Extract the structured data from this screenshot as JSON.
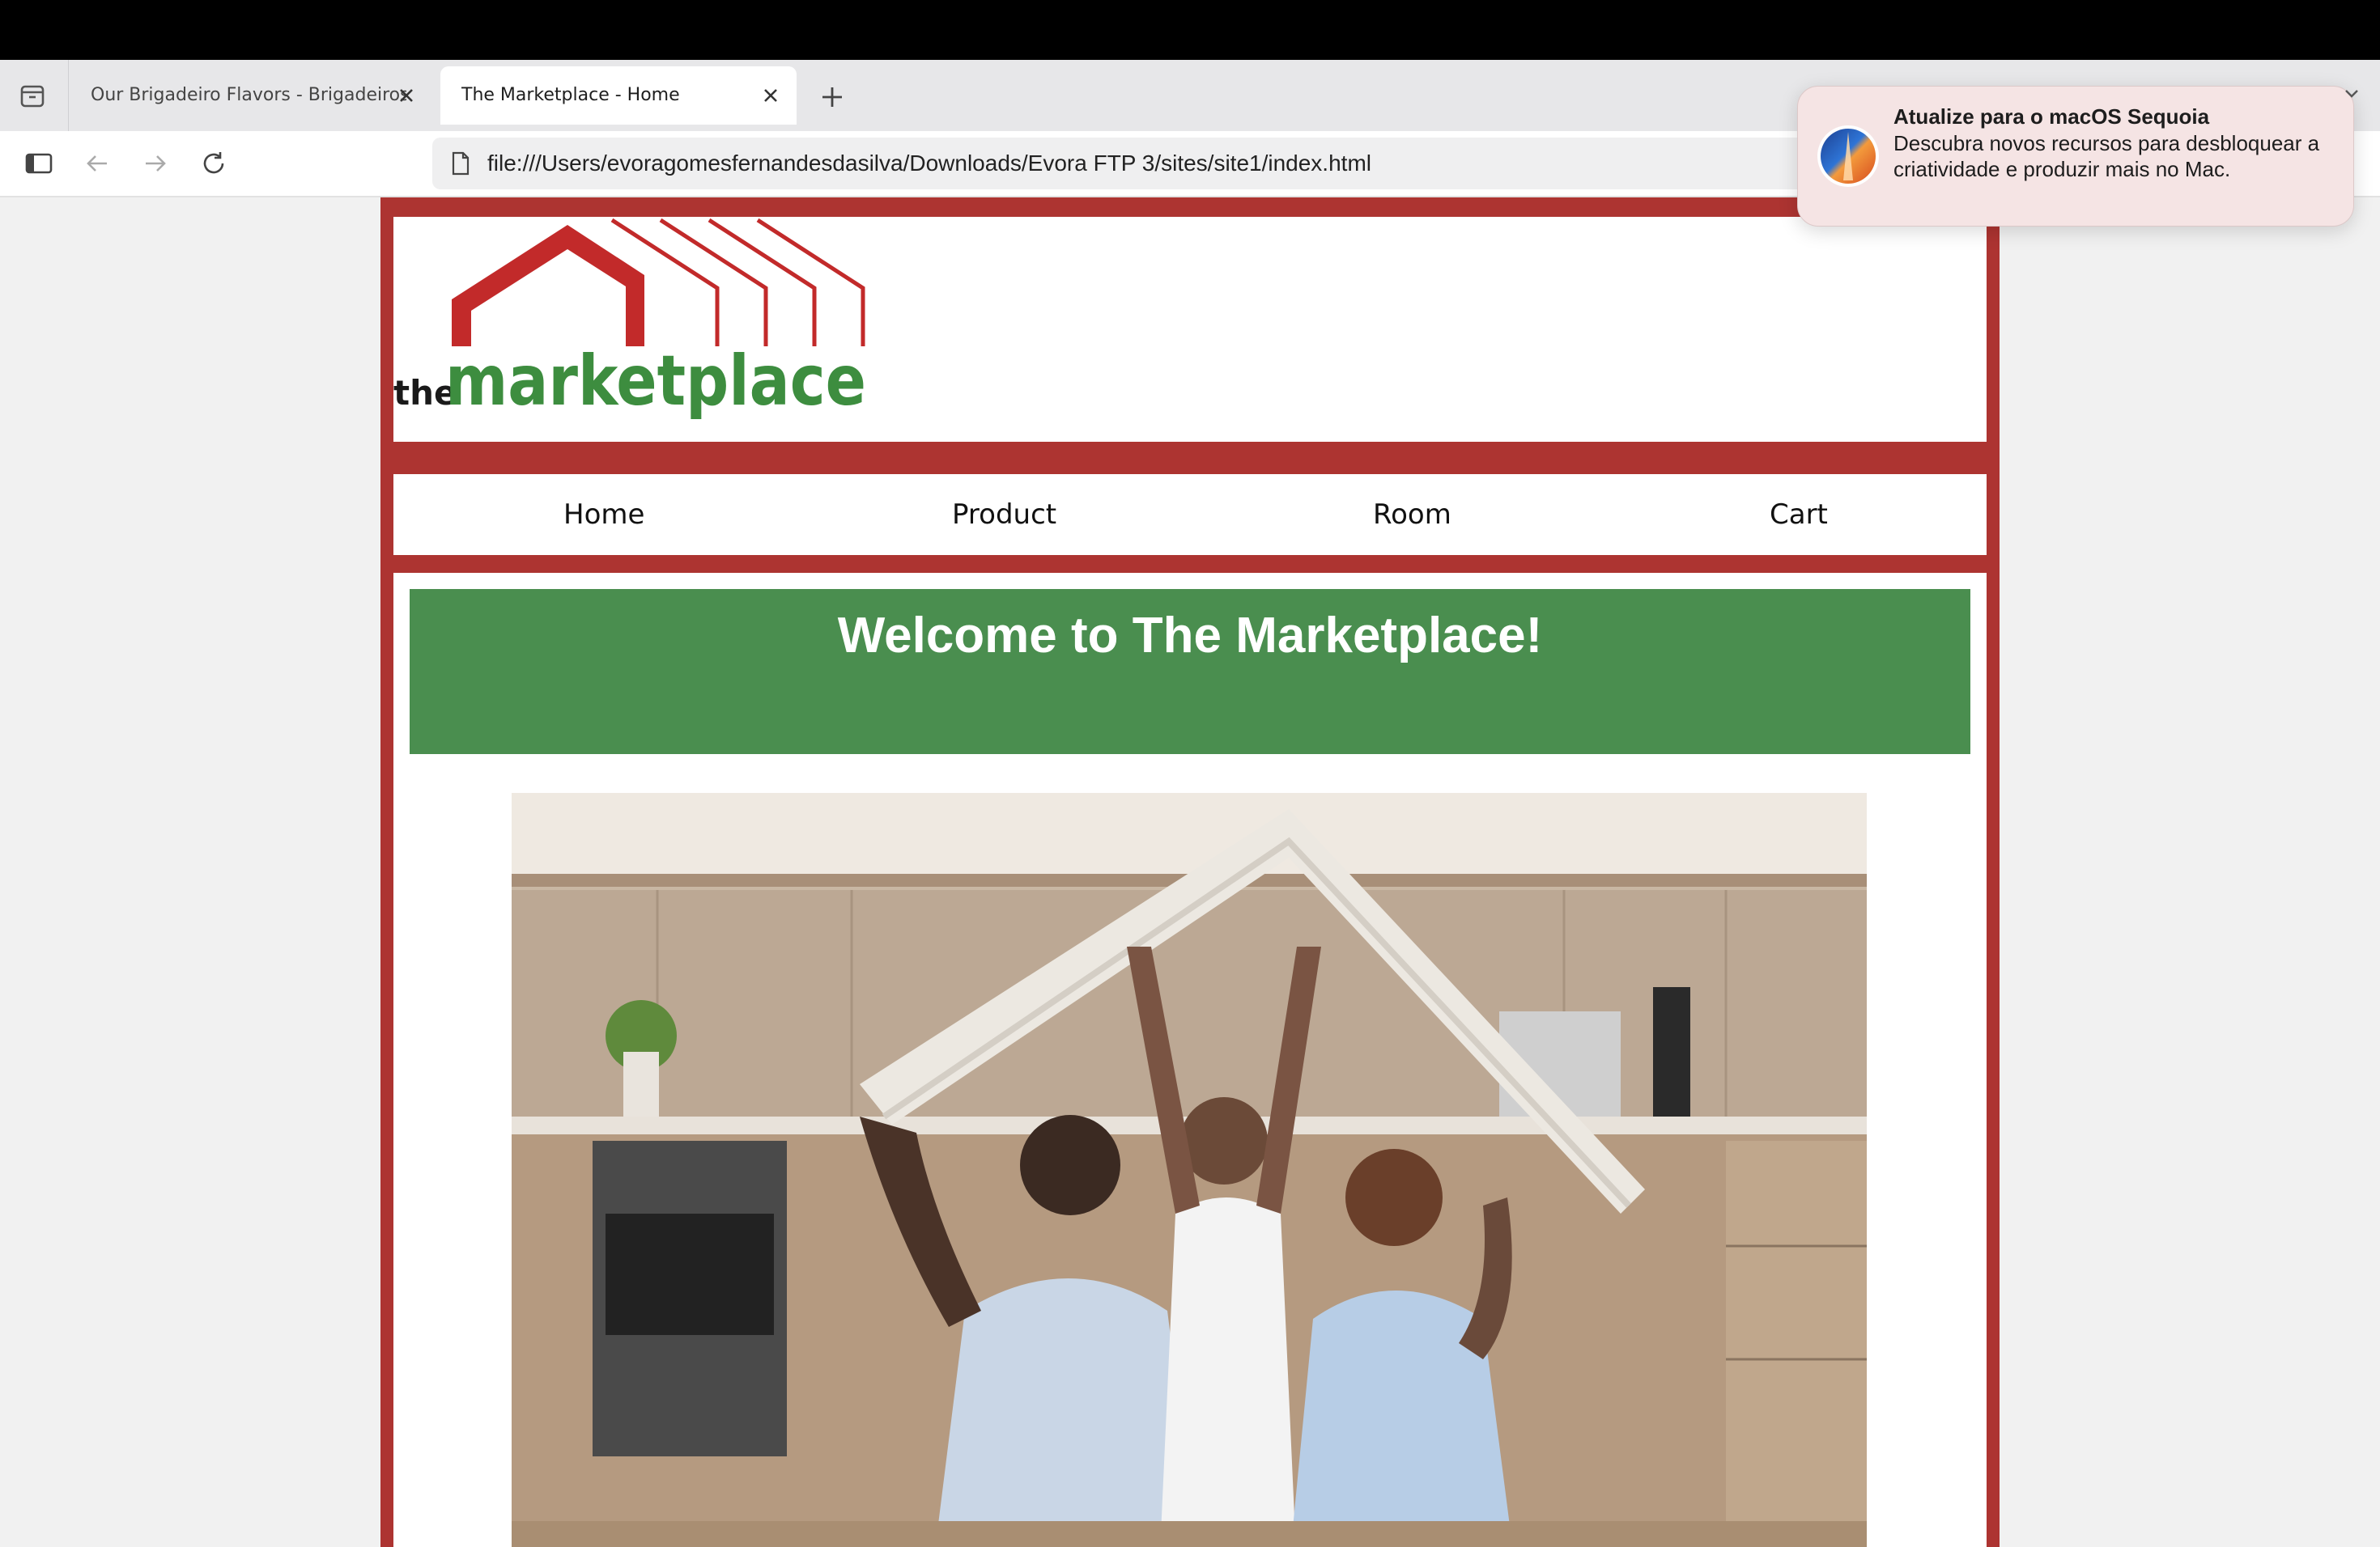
{
  "browser": {
    "tabs": [
      {
        "label": "Our Brigadeiro Flavors - Brigadeiros",
        "active": false
      },
      {
        "label": "The Marketplace - Home",
        "active": true
      }
    ],
    "address": "file:///Users/evoragomesfernandesdasilva/Downloads/Evora FTP 3/sites/site1/index.html",
    "icons": [
      "tab-overview-icon",
      "close-icon",
      "new-tab-icon",
      "sidebar-icon",
      "back-icon",
      "forward-icon",
      "reload-icon",
      "document-icon"
    ]
  },
  "notification": {
    "title": "Atualize para o macOS Sequoia",
    "body": "Descubra novos recursos para desbloquear a criatividade e produzir mais no Mac.",
    "icon": "macos-sequoia-icon"
  },
  "site": {
    "logo": {
      "small": "the",
      "main": "marketplace"
    },
    "nav": [
      "Home",
      "Product",
      "Room",
      "Cart"
    ],
    "welcome": "Welcome to The Marketplace!",
    "hero_image": "family-holding-roof-photo",
    "colors": {
      "frame": "#ad3431",
      "banner": "#4a8e4f",
      "logo_green": "#3d8d3f",
      "logo_red": "#c22a2a"
    }
  }
}
